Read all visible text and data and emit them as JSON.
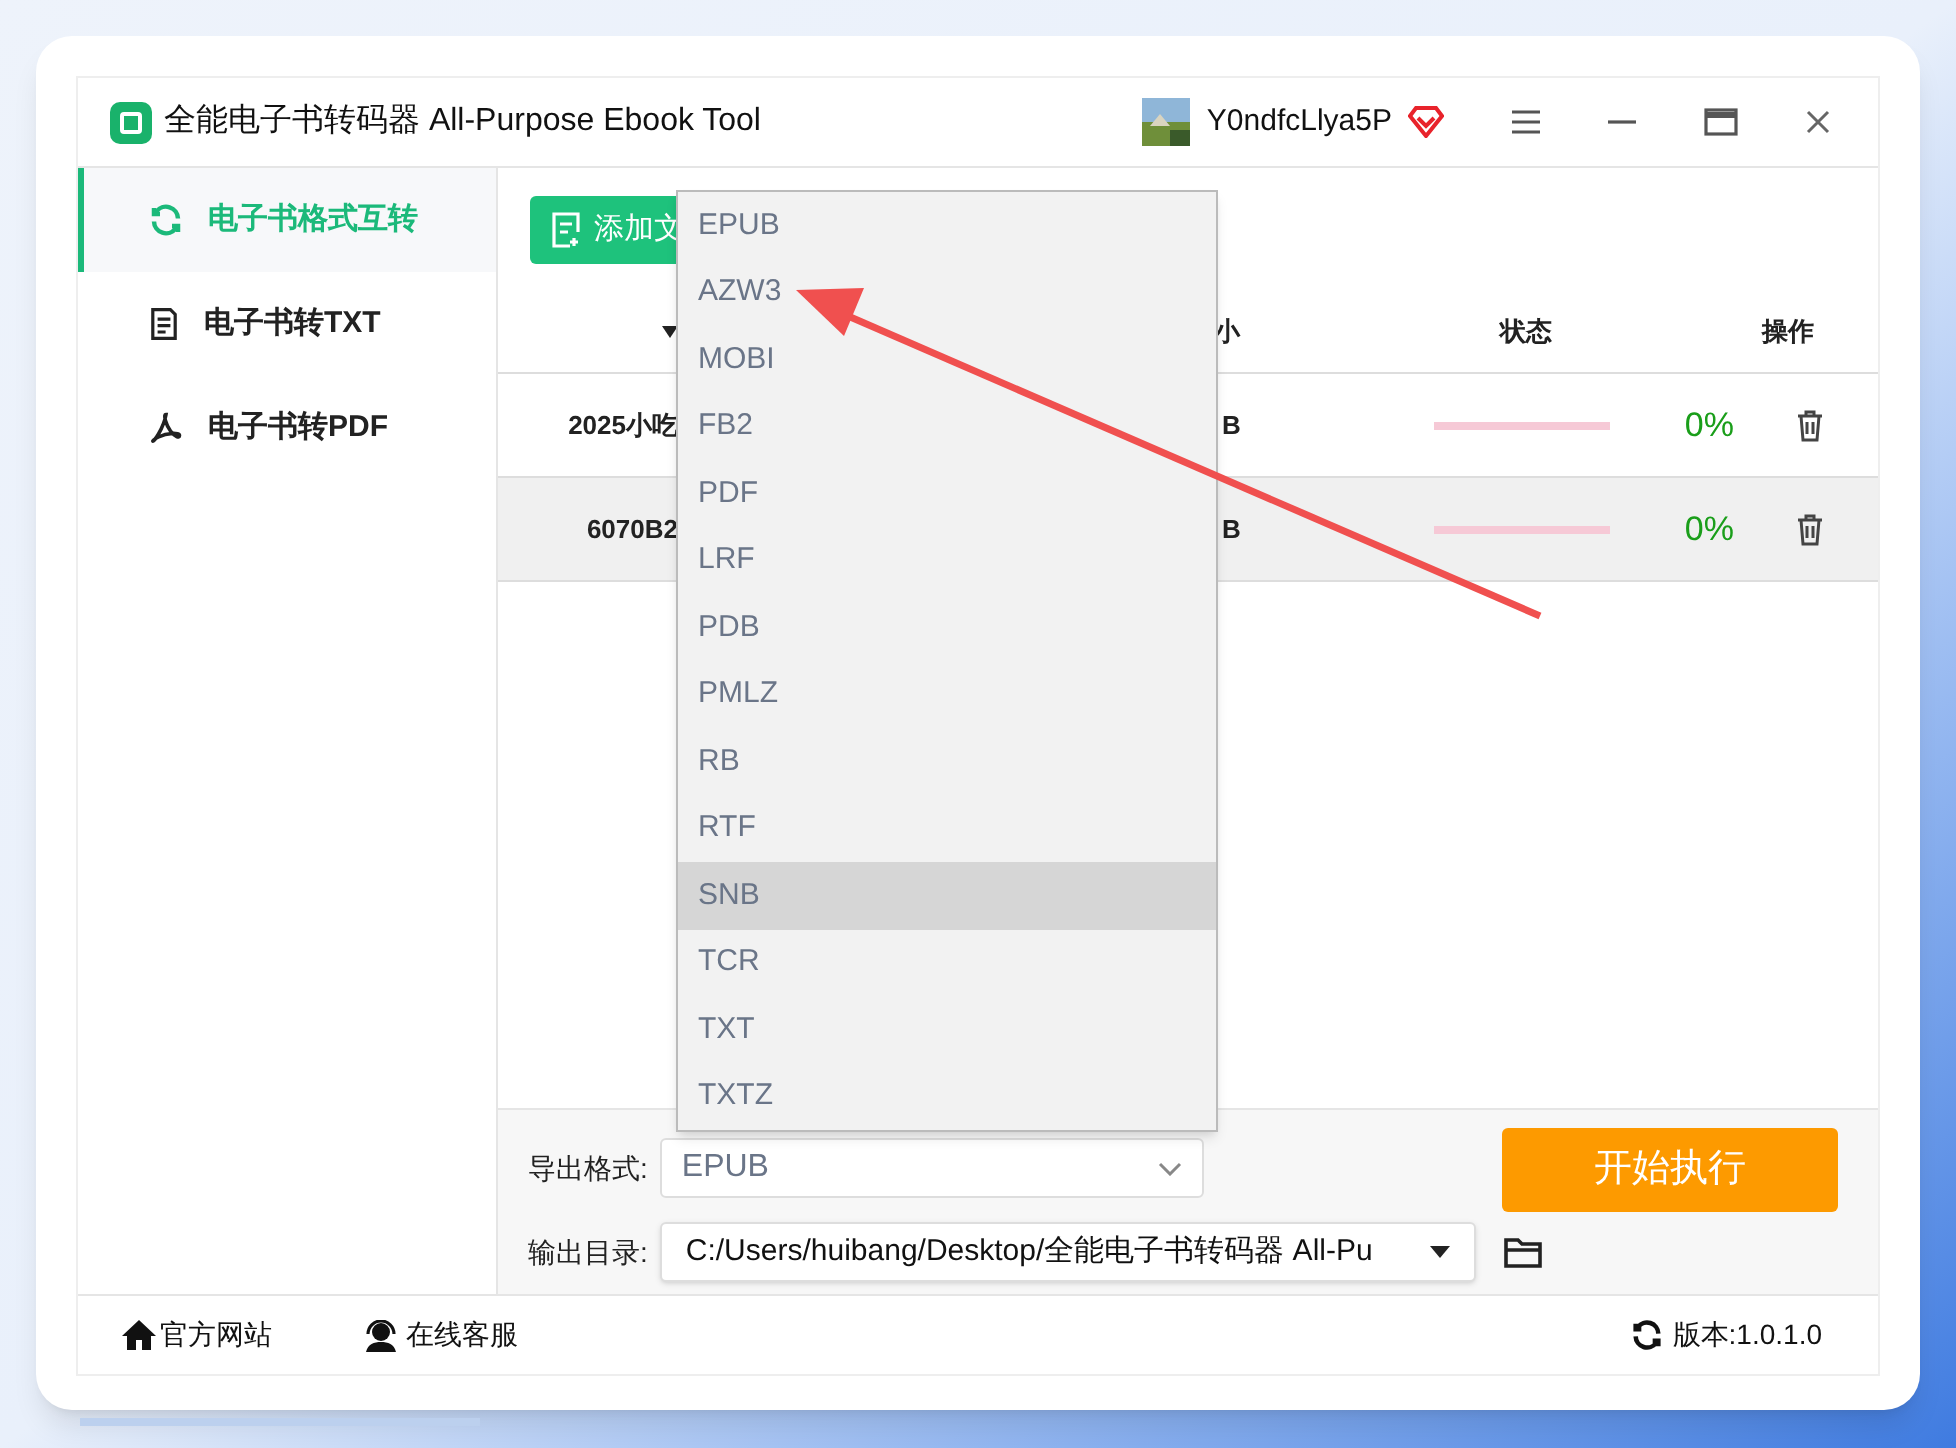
{
  "window": {
    "title": "全能电子书转码器 All-Purpose Ebook Tool",
    "username": "Y0ndfcLlya5P"
  },
  "sidebar": {
    "items": [
      {
        "label": "电子书格式互转",
        "selected": true
      },
      {
        "label": "电子书转TXT",
        "selected": false
      },
      {
        "label": "电子书转PDF",
        "selected": false
      }
    ]
  },
  "add_button": {
    "label": "添加文"
  },
  "table": {
    "columns": [
      "小",
      "状态",
      "操作"
    ],
    "rows": [
      {
        "column_1": "2025小吃",
        "column_2": "B",
        "progress": {
          "level": 0,
          "reading": "0%"
        },
        "selected": false
      },
      {
        "column_1": "6070B2",
        "column_2": "B",
        "progress": {
          "level": 0,
          "reading": "0%"
        },
        "selected": true
      }
    ]
  },
  "format_dropdown": {
    "options": [
      {
        "label": "EPUB",
        "highlighted": false
      },
      {
        "label": "AZW3",
        "highlighted": false
      },
      {
        "label": "MOBI",
        "highlighted": false
      },
      {
        "label": "FB2",
        "highlighted": false
      },
      {
        "label": "PDF",
        "highlighted": false
      },
      {
        "label": "LRF",
        "highlighted": false
      },
      {
        "label": "PDB",
        "highlighted": false
      },
      {
        "label": "PMLZ",
        "highlighted": false
      },
      {
        "label": "RB",
        "highlighted": false
      },
      {
        "label": "RTF",
        "highlighted": false
      },
      {
        "label": "SNB",
        "highlighted": true
      },
      {
        "label": "TCR",
        "highlighted": false
      },
      {
        "label": "TXT",
        "highlighted": false
      },
      {
        "label": "TXTZ",
        "highlighted": false
      }
    ]
  },
  "export_format": {
    "label": "导出格式:",
    "value": "EPUB"
  },
  "output_dir": {
    "label": "输出目录:",
    "value": "C:/Users/huibang/Desktop/全能电子书转码器 All-Pu"
  },
  "start_button": {
    "label": "开始执行"
  },
  "status_bar": {
    "website": "官方网站",
    "support": "在线客服",
    "version": "版本:1.0.1.0"
  }
}
